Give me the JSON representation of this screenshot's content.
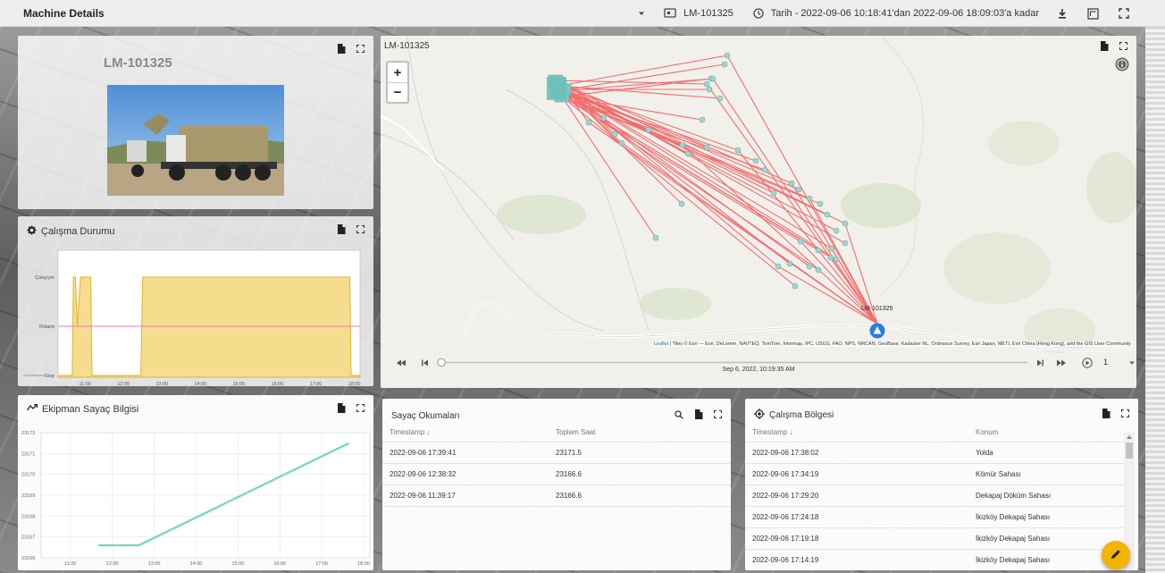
{
  "header": {
    "title": "Machine Details",
    "machine": "LM-101325",
    "date_range": "Tarih - 2022-09-06 10:18:41'dan 2022-09-06 18:09:03'a kadar"
  },
  "machine_panel": {
    "name": "LM-101325"
  },
  "status_panel": {
    "title": "Çalışma Durumu",
    "y_labels": [
      "Çalışıyor",
      "Rölanti",
      "Stop"
    ],
    "x_labels": [
      "11:00",
      "12:00",
      "13:00",
      "14:00",
      "15:00",
      "16:00",
      "17:00",
      "18:00"
    ]
  },
  "map_panel": {
    "title": "LM-101325",
    "marker_label": "LM-101325",
    "zoom_in": "+",
    "zoom_out": "−",
    "attribution_link": "Leaflet",
    "attribution": " | Tiles © Esri — Esri, DeLorme, NAVTEQ, TomTom, Intermap, iPC, USGS, FAO, NPS, NRCAN, GeoBase, Kadaster NL, Ordnance Survey, Esri Japan, METI, Esri China (Hong Kong), and the GIS User Community",
    "playback_time": "Sep 6, 2022, 10:19:35 AM",
    "speed": "1"
  },
  "counter_panel": {
    "title": "Ekipman Sayaç Bilgisi",
    "y_labels": [
      "23172",
      "23171",
      "23170",
      "23169",
      "23168",
      "23167",
      "23166"
    ],
    "x_labels": [
      "11:00",
      "12:00",
      "13:00",
      "14:00",
      "15:00",
      "16:00",
      "17:00",
      "18:00"
    ]
  },
  "readings_panel": {
    "title": "Sayaç Okumaları",
    "columns": [
      "Timestamp ↓",
      "Toplam Saat"
    ],
    "rows": [
      [
        "2022-09-06 17:39:41",
        "23171.5"
      ],
      [
        "2022-09-06 12:38:32",
        "23166.6"
      ],
      [
        "2022-09-06 11:39:17",
        "23166.6"
      ]
    ]
  },
  "region_panel": {
    "title": "Çalışma Bölgesi",
    "columns": [
      "Timestamp ↓",
      "Konum"
    ],
    "rows": [
      [
        "2022-09-06 17:38:02",
        "Yolda"
      ],
      [
        "2022-09-06 17:34:19",
        "Kömür Sahası"
      ],
      [
        "2022-09-06 17:29:20",
        "Dekapaj Döküm Sahası"
      ],
      [
        "2022-09-06 17:24:18",
        "İkizköy Dekapaj Sahası"
      ],
      [
        "2022-09-06 17:19:18",
        "İkizköy Dekapaj Sahası"
      ],
      [
        "2022-09-06 17:14:19",
        "İkizköy Dekapaj Sahası"
      ]
    ]
  },
  "chart_data": [
    {
      "type": "area",
      "title": "Çalışma Durumu",
      "y_categories": [
        "Stop",
        "Rölanti",
        "Çalışıyor"
      ],
      "x_range": [
        "10:18",
        "18:09"
      ],
      "reference_line": "Rölanti",
      "series": [
        {
          "x": [
            "10:18",
            "10:40",
            "10:42",
            "10:45",
            "10:48",
            "10:53",
            "10:55",
            "11:09",
            "11:11",
            "12:27",
            "12:30",
            "17:53",
            "17:55",
            "18:09"
          ],
          "y": [
            "Stop",
            "Stop",
            "Çalışıyor",
            "Çalışıyor",
            "Rölanti",
            "Çalışıyor",
            "Çalışıyor",
            "Çalışıyor",
            "Stop",
            "Stop",
            "Çalışıyor",
            "Çalışıyor",
            "Stop",
            "Stop"
          ]
        }
      ],
      "colors": {
        "fill": "#f5d779",
        "line": "#e0b32c",
        "reference": "#e879c8"
      }
    },
    {
      "type": "line",
      "title": "Ekipman Sayaç Bilgisi",
      "ylim": [
        23166,
        23172
      ],
      "series": [
        {
          "x": [
            "11:40",
            "12:38",
            "17:39"
          ],
          "y": [
            23166.6,
            23166.6,
            23171.5
          ]
        }
      ],
      "colors": {
        "line": "#6fd8c4"
      }
    }
  ]
}
